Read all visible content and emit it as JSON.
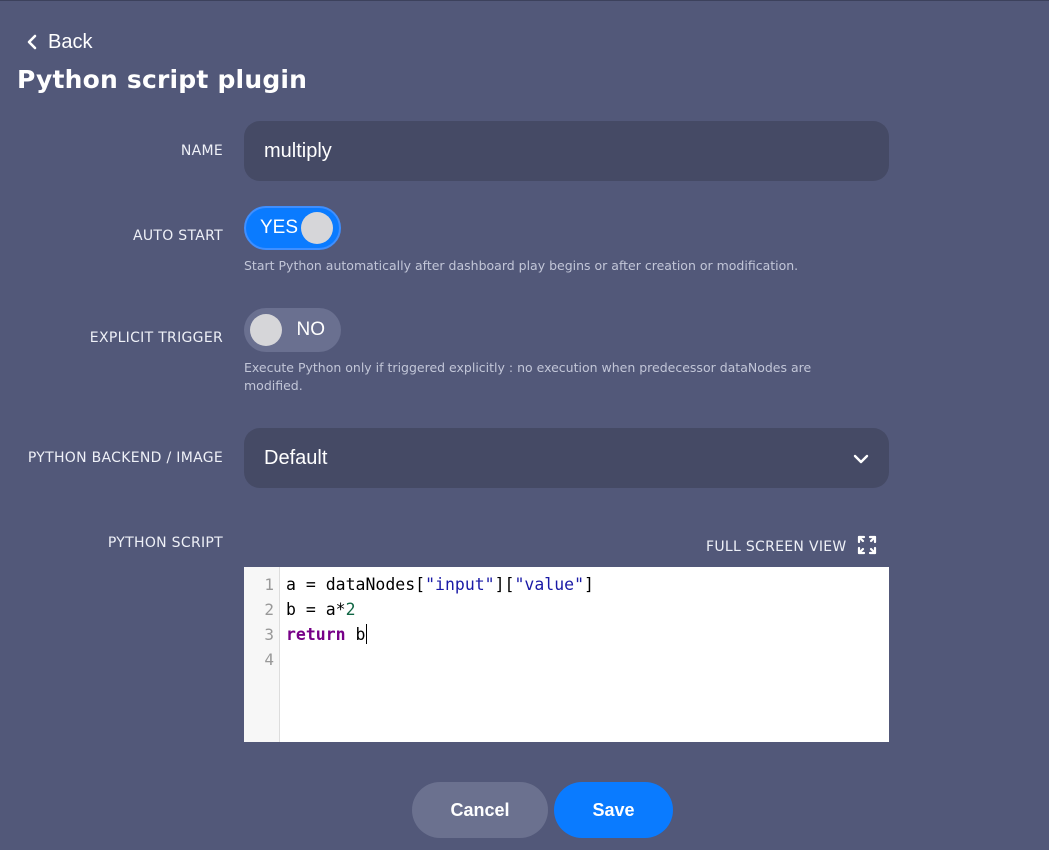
{
  "nav": {
    "back_label": "Back"
  },
  "page": {
    "title": "Python script plugin"
  },
  "form": {
    "name": {
      "label": "NAME",
      "value": "multiply"
    },
    "auto_start": {
      "label": "AUTO START",
      "state": "YES",
      "enabled": true,
      "help": "Start Python automatically after dashboard play begins or after creation or modification."
    },
    "explicit_trigger": {
      "label": "EXPLICIT TRIGGER",
      "state": "NO",
      "enabled": false,
      "help": "Execute Python only if triggered explicitly : no execution when predecessor dataNodes are modified."
    },
    "backend": {
      "label": "PYTHON BACKEND / IMAGE",
      "selected": "Default"
    },
    "script": {
      "label": "PYTHON SCRIPT",
      "fullscreen_label": "FULL SCREEN VIEW",
      "line_numbers": [
        "1",
        "2",
        "3",
        "4"
      ],
      "lines": [
        "a = dataNodes[\"input\"][\"value\"]",
        "b = a*2",
        "return b",
        ""
      ]
    }
  },
  "actions": {
    "cancel_label": "Cancel",
    "save_label": "Save"
  },
  "colors": {
    "background": "#525879",
    "input_bg": "#454a65",
    "accent": "#0a7bff",
    "toggle_off": "#6a7090",
    "cancel_bg": "#6b718f"
  },
  "icons": {
    "back": "chevron-left-icon",
    "select": "chevron-down-icon",
    "fullscreen": "expand-icon"
  }
}
